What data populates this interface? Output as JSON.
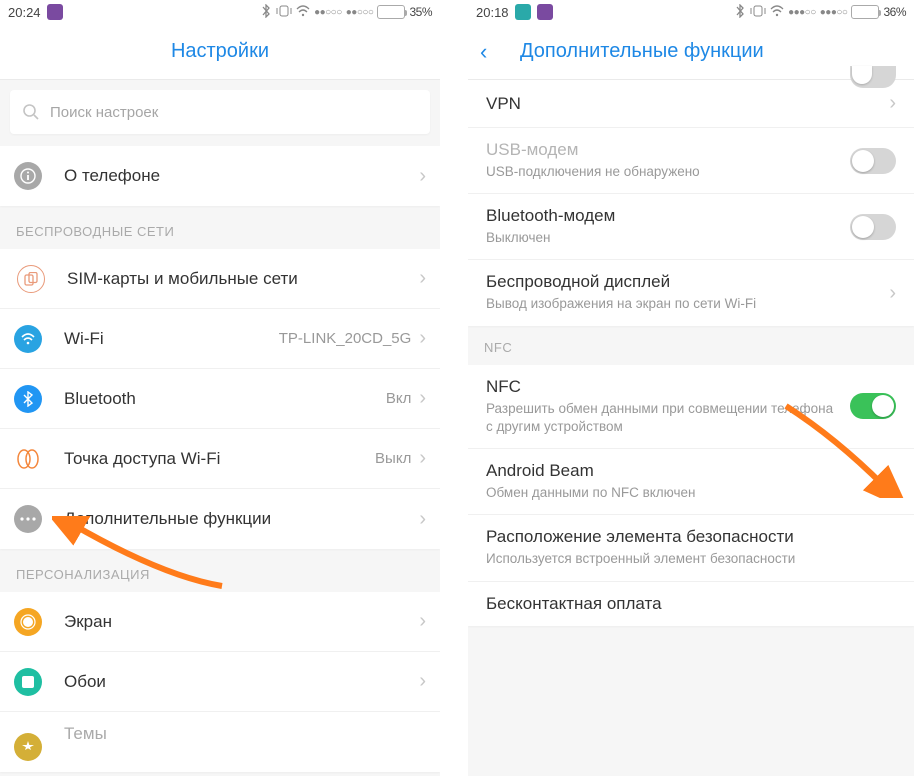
{
  "left": {
    "status": {
      "time": "20:24",
      "battery_pct": "35%",
      "battery_fill": "35%"
    },
    "title": "Настройки",
    "search_placeholder": "Поиск настроек",
    "about_label": "О телефоне",
    "section_wireless": "БЕСПРОВОДНЫЕ СЕТИ",
    "wireless": [
      {
        "label": "SIM-карты и мобильные сети",
        "value": ""
      },
      {
        "label": "Wi-Fi",
        "value": "TP-LINK_20CD_5G"
      },
      {
        "label": "Bluetooth",
        "value": "Вкл"
      },
      {
        "label": "Точка доступа Wi-Fi",
        "value": "Выкл"
      },
      {
        "label": "Дополнительные функции",
        "value": ""
      }
    ],
    "section_personal": "ПЕРСОНАЛИЗАЦИЯ",
    "personal": [
      {
        "label": "Экран"
      },
      {
        "label": "Обои"
      },
      {
        "label": "Темы"
      }
    ]
  },
  "right": {
    "status": {
      "time": "20:18",
      "battery_pct": "36%",
      "battery_fill": "36%"
    },
    "title": "Дополнительные функции",
    "vpn": "VPN",
    "usb_modem": {
      "title": "USB-модем",
      "sub": "USB-подключения не обнаружено"
    },
    "bt_modem": {
      "title": "Bluetooth-модем",
      "sub": "Выключен"
    },
    "wireless_display": {
      "title": "Беспроводной дисплей",
      "sub": "Вывод изображения на экран по сети Wi-Fi"
    },
    "section_nfc": "NFC",
    "nfc": {
      "title": "NFC",
      "sub": "Разрешить обмен данными при совмещении телефона с другим устройством"
    },
    "android_beam": {
      "title": "Android Beam",
      "sub": "Обмен данными по NFC включен"
    },
    "secure_element": {
      "title": "Расположение элемента безопасности",
      "sub": "Используется встроенный элемент безопасности"
    },
    "contactless": {
      "title": "Бесконтактная оплата"
    }
  }
}
